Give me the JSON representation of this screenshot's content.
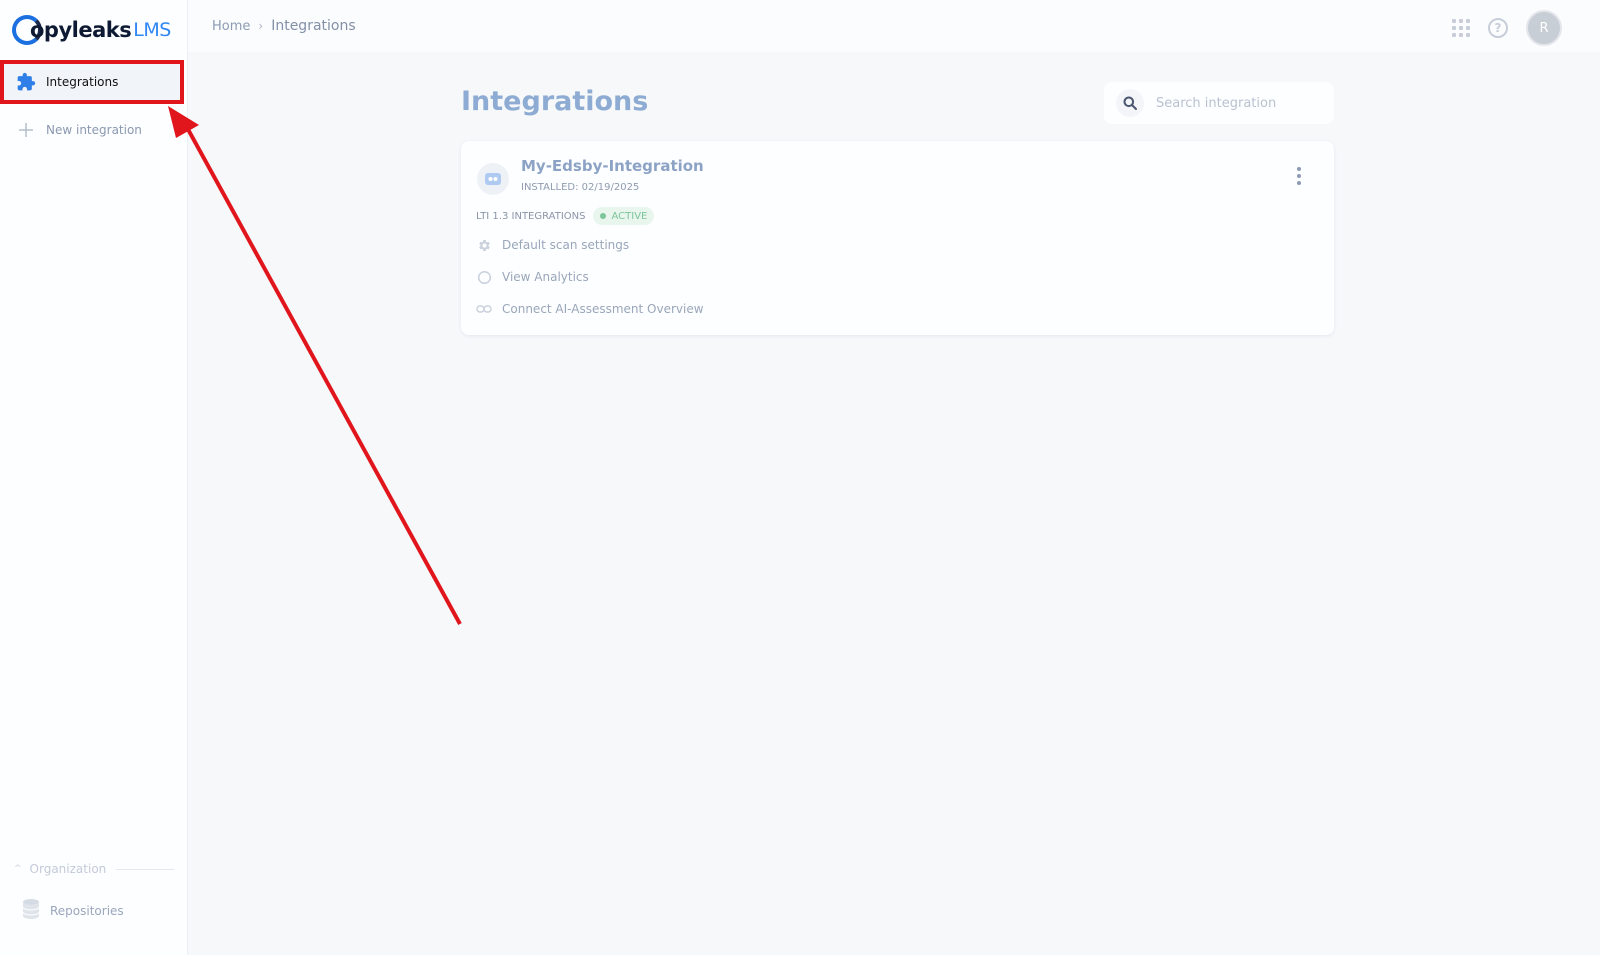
{
  "brand": {
    "name": "opyleaks",
    "suffix": "LMS"
  },
  "sidebar": {
    "items": [
      {
        "label": "Integrations",
        "icon": "puzzle-icon",
        "active": true
      },
      {
        "label": "New integration",
        "icon": "plus-icon",
        "active": false
      }
    ],
    "section": {
      "label": "Organization"
    },
    "section_items": [
      {
        "label": "Repositories",
        "icon": "database-icon"
      }
    ]
  },
  "topbar": {
    "breadcrumb": [
      "Home",
      "Integrations"
    ],
    "avatar_initial": "R"
  },
  "main": {
    "title": "Integrations",
    "search": {
      "placeholder": "Search integration",
      "value": ""
    },
    "integration": {
      "name": "My-Edsby-Integration",
      "installed": "INSTALLED: 02/19/2025",
      "type": "LTI 1.3 INTEGRATIONS",
      "status": "ACTIVE",
      "links": [
        {
          "label": "Default scan settings",
          "icon": "gear-icon"
        },
        {
          "label": "View Analytics",
          "icon": "circle-icon"
        },
        {
          "label": "Connect AI-Assessment Overview",
          "icon": "link-icon"
        }
      ]
    }
  },
  "colors": {
    "accent": "#2f86f5",
    "annotation": "#e0161c",
    "active_status": "#7bc59a"
  }
}
